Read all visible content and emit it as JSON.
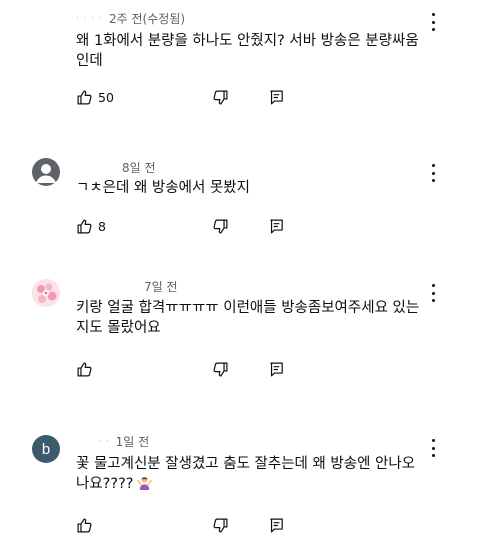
{
  "comments": [
    {
      "handle": "· · · ·",
      "time": "2주 전(수정됨)",
      "lines": [
        "왜 1화에서 분량을 하나도 안줬지? 서바 방송은 분량싸움",
        "인데"
      ],
      "likes": "50",
      "avatar": "none",
      "menu_icon": "more-vert-icon"
    },
    {
      "handle": "",
      "time": "8일 전",
      "lines": [
        "ㄱㅊ은데 왜 방송에서 못봤지"
      ],
      "likes": "8",
      "avatar": "default-gray-person",
      "menu_icon": "more-vert-icon"
    },
    {
      "handle": "",
      "time": "7일 전",
      "lines": [
        "키랑 얼굴 합격ㅠㅠㅠㅠ 이런애들 방송좀보여주세요 있는",
        "지도 몰랐어요"
      ],
      "likes": "",
      "avatar": "pink-cherry-blossom",
      "menu_icon": "more-vert-icon"
    },
    {
      "handle": "· ·",
      "time": "1일 전",
      "lines": [
        "꽃 물고계신분 잘생겼고 춤도 잘추는데 왜 방송엔 안나오",
        "나요????"
      ],
      "likes": "",
      "avatar": "letter-b",
      "avatar_letter": "b",
      "emoji": "person-shrugging-emoji",
      "menu_icon": "more-vert-icon"
    }
  ],
  "icons": {
    "like": "thumb-up-outline-icon",
    "dislike": "thumb-down-outline-icon",
    "reply": "reply-comment-icon"
  },
  "colors": {
    "text": "#0f0f0f",
    "meta": "#606060",
    "avatar_gray": "#5f6368",
    "avatar_b": "#3d5a6c",
    "avatar_pink": "#f8c9d4"
  }
}
